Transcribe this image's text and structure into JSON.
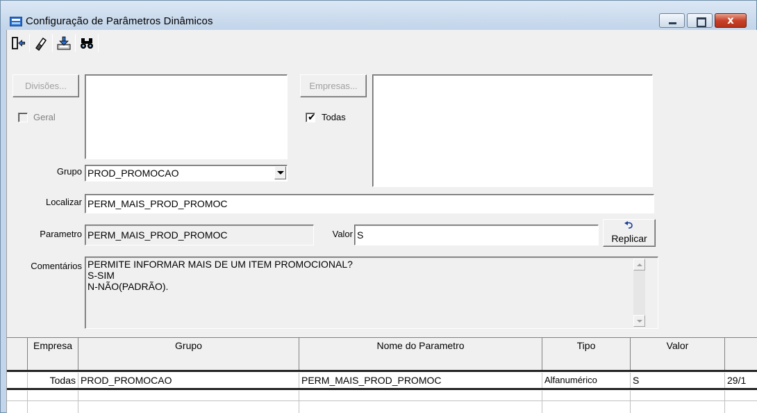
{
  "window": {
    "title": "Configuração de Parâmetros Dinâmicos",
    "close_glyph": "x"
  },
  "toolbar": {
    "buttons": [
      "exit-door-icon",
      "eraser-icon",
      "save-download-icon",
      "binoculars-search-icon"
    ]
  },
  "divisoes": {
    "button_label": "Divisões...",
    "geral_label": "Geral",
    "geral_checked": false
  },
  "empresas": {
    "button_label": "Empresas...",
    "todas_label": "Todas",
    "todas_checked": true
  },
  "grupo": {
    "label": "Grupo",
    "value": "PROD_PROMOCAO"
  },
  "localizar": {
    "label": "Localizar",
    "value": "PERM_MAIS_PROD_PROMOC"
  },
  "parametro": {
    "label": "Parametro",
    "value": "PERM_MAIS_PROD_PROMOC"
  },
  "valor": {
    "label": "Valor",
    "value": "S"
  },
  "replicar": {
    "label": "Replicar"
  },
  "comentarios": {
    "label": "Comentários",
    "lines": [
      "PERMITE INFORMAR MAIS DE UM ITEM PROMOCIONAL?",
      "S-SIM",
      "N-NÃO(PADRÃO)."
    ]
  },
  "table": {
    "columns": [
      "",
      "Empresa",
      "Grupo",
      "Nome do Parametro",
      "Tipo",
      "Valor",
      ""
    ],
    "rows": [
      [
        "",
        "Todas",
        "PROD_PROMOCAO",
        "PERM_MAIS_PROD_PROMOC",
        "Alfanumérico",
        "S",
        "29/1"
      ]
    ]
  }
}
